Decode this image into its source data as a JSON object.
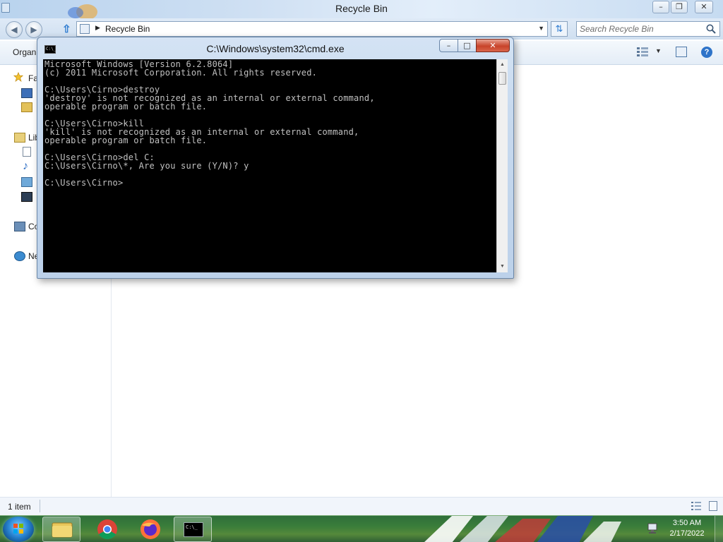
{
  "explorer": {
    "title": "Recycle Bin",
    "address": "Recycle Bin",
    "search_placeholder": "Search Recycle Bin",
    "toolbar": {
      "organize_label": "Organ"
    },
    "nav": {
      "favorites_label": "Fa",
      "libraries_label": "Lib",
      "computer_label": "Co",
      "network_label": "Ne"
    },
    "status": {
      "item_count": "1 item"
    }
  },
  "cmd": {
    "title": "C:\\Windows\\system32\\cmd.exe",
    "icon_text": "C:\\_",
    "lines": [
      "Microsoft Windows [Version 6.2.8064]",
      "(c) 2011 Microsoft Corporation. All rights reserved.",
      "",
      "C:\\Users\\Cirno>destroy",
      "'destroy' is not recognized as an internal or external command,",
      "operable program or batch file.",
      "",
      "C:\\Users\\Cirno>kill",
      "'kill' is not recognized as an internal or external command,",
      "operable program or batch file.",
      "",
      "C:\\Users\\Cirno>del C:",
      "C:\\Users\\Cirno\\*, Are you sure (Y/N)? y",
      "",
      "C:\\Users\\Cirno>"
    ]
  },
  "taskbar": {
    "clock_time": "3:50 AM",
    "clock_date": "2/17/2022",
    "cmd_button_text": "C:\\_"
  },
  "colors": {
    "console_bg": "#000000",
    "console_text": "#c0c0c0",
    "close_button": "#c8432a",
    "taskbar": "#3a7d3a"
  }
}
